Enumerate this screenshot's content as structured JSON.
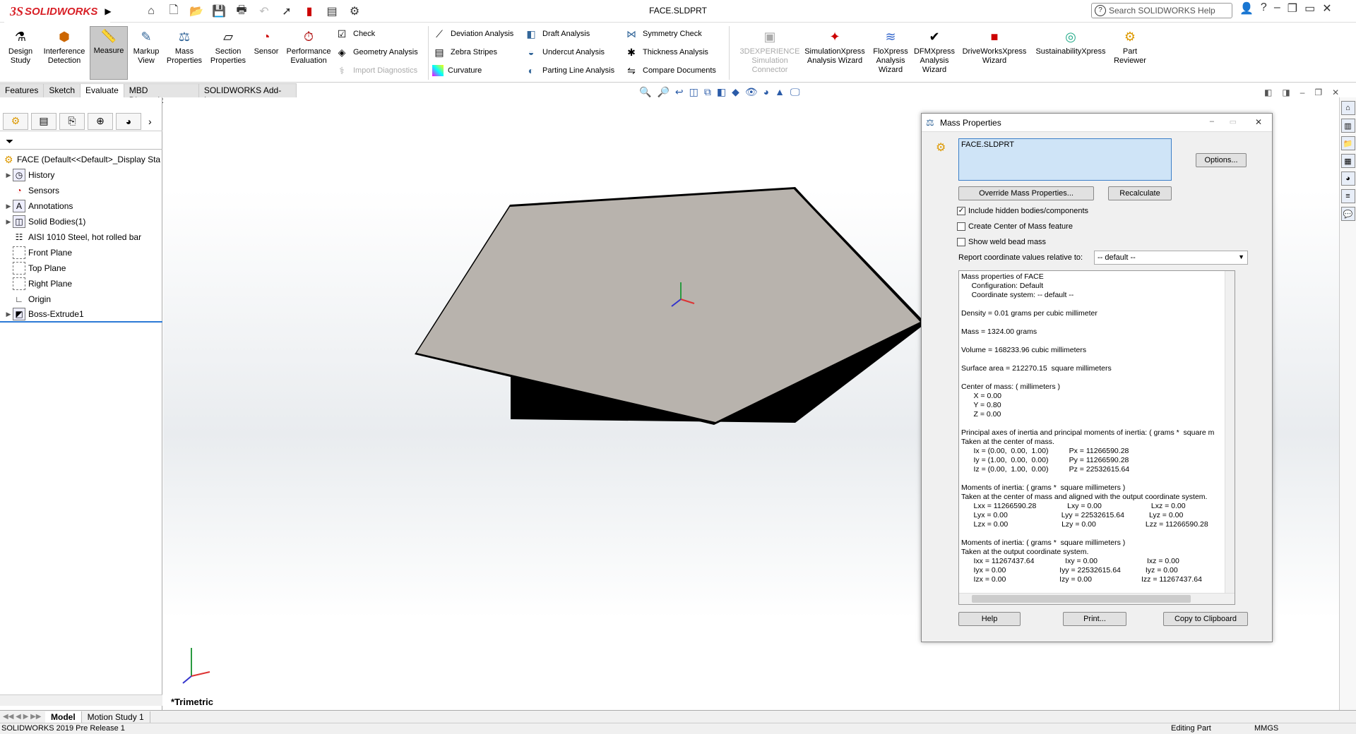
{
  "app": {
    "logo_ds": "3S",
    "logo_name": "SOLIDWORKS",
    "doc_title": "FACE.SLDPRT",
    "search_placeholder": "Search SOLIDWORKS Help"
  },
  "ribbon": {
    "design_study": "Design Study",
    "interference": "Interference Detection",
    "measure": "Measure",
    "markup": "Markup View",
    "mass": "Mass Properties",
    "section": "Section Properties",
    "sensor": "Sensor",
    "perf": "Performance Evaluation",
    "check": "Check",
    "geom": "Geometry Analysis",
    "import": "Import Diagnostics",
    "deviation": "Deviation Analysis",
    "zebra": "Zebra Stripes",
    "curvature": "Curvature",
    "draft": "Draft Analysis",
    "undercut": "Undercut Analysis",
    "parting": "Parting Line Analysis",
    "symmetry": "Symmetry Check",
    "thickness": "Thickness Analysis",
    "compare": "Compare Documents",
    "sim_conn": "3DEXPERIENCE Simulation Connector",
    "simx": "SimulationXpress Analysis Wizard",
    "flox": "FloXpress Analysis Wizard",
    "dfmx": "DFMXpress Analysis Wizard",
    "driveworks": "DriveWorksXpress Wizard",
    "sustain": "SustainabilityXpress",
    "reviewer": "Part Reviewer"
  },
  "cmdtabs": [
    "Features",
    "Sketch",
    "Evaluate",
    "MBD Dimensions",
    "SOLIDWORKS Add-Ins"
  ],
  "tree": {
    "root": "FACE  (Default<<Default>_Display Sta",
    "items": [
      "History",
      "Sensors",
      "Annotations",
      "Solid Bodies(1)",
      "AISI 1010 Steel, hot rolled bar",
      "Front Plane",
      "Top Plane",
      "Right Plane",
      "Origin",
      "Boss-Extrude1"
    ]
  },
  "viewport": {
    "view_name": "*Trimetric"
  },
  "bottom_tabs": [
    "Model",
    "Motion Study 1"
  ],
  "status": {
    "version": "SOLIDWORKS 2019 Pre Release 1",
    "mode": "Editing Part",
    "units": "MMGS"
  },
  "dialog": {
    "title": "Mass Properties",
    "selection": "FACE.SLDPRT",
    "options": "Options...",
    "override": "Override Mass Properties...",
    "recalc": "Recalculate",
    "chk_hidden": "Include hidden bodies/components",
    "chk_com": "Create Center of Mass feature",
    "chk_weld": "Show weld bead mass",
    "report_label": "Report coordinate values relative to:",
    "report_value": "-- default --",
    "help": "Help",
    "print": "Print...",
    "copy": "Copy to Clipboard",
    "results": "Mass properties of FACE\n     Configuration: Default\n     Coordinate system: -- default --\n\nDensity = 0.01 grams per cubic millimeter\n\nMass = 1324.00 grams\n\nVolume = 168233.96 cubic millimeters\n\nSurface area = 212270.15  square millimeters\n\nCenter of mass: ( millimeters )\n      X = 0.00\n      Y = 0.80\n      Z = 0.00\n\nPrincipal axes of inertia and principal moments of inertia: ( grams *  square m\nTaken at the center of mass.\n      Ix = (0.00,  0.00,  1.00)          Px = 11266590.28\n      Iy = (1.00,  0.00,  0.00)          Py = 11266590.28\n      Iz = (0.00,  1.00,  0.00)          Pz = 22532615.64\n\nMoments of inertia: ( grams *  square millimeters )\nTaken at the center of mass and aligned with the output coordinate system.\n      Lxx = 11266590.28               Lxy = 0.00                        Lxz = 0.00\n      Lyx = 0.00                          Lyy = 22532615.64            Lyz = 0.00\n      Lzx = 0.00                          Lzy = 0.00                        Lzz = 11266590.28\n\nMoments of inertia: ( grams *  square millimeters )\nTaken at the output coordinate system.\n      Ixx = 11267437.64               Ixy = 0.00                        Ixz = 0.00\n      Iyx = 0.00                          Iyy = 22532615.64            Iyz = 0.00\n      Izx = 0.00                          Izy = 0.00                        Izz = 11267437.64"
  }
}
